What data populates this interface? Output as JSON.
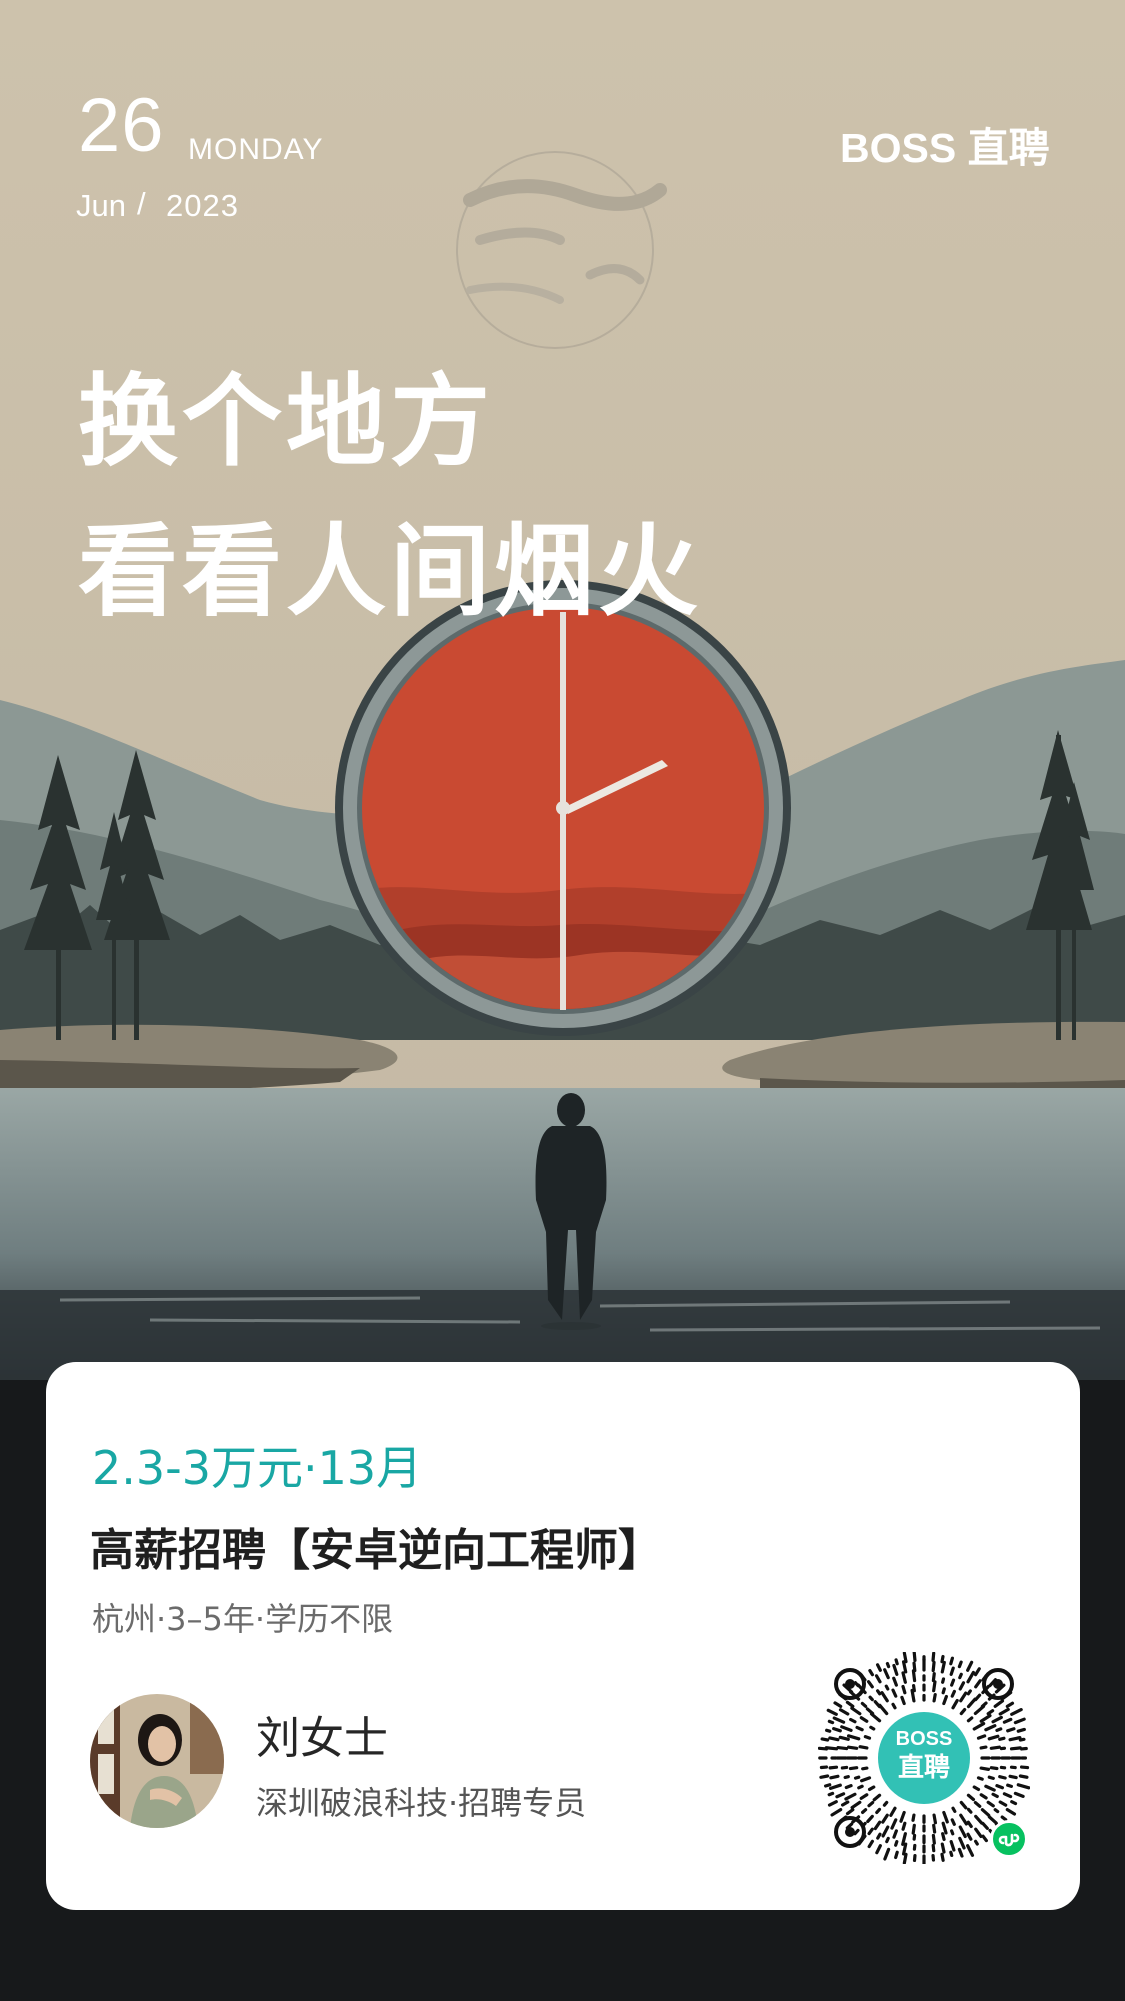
{
  "header": {
    "day": "26",
    "weekday": "MONDAY",
    "month": "Jun",
    "separator": "/",
    "year": "2023",
    "brand": "BOSS 直聘"
  },
  "headline": {
    "line1": "换个地方",
    "line2": "看看人间烟火"
  },
  "job": {
    "salary": "2.3-3万元·13月",
    "title": "高薪招聘【安卓逆向工程师】",
    "meta": "杭州·3–5年·学历不限"
  },
  "recruiter": {
    "name": "刘女士",
    "company": "深圳破浪科技·招聘专员"
  },
  "qr": {
    "badge_line1": "BOSS",
    "badge_line2": "直聘"
  },
  "colors": {
    "accent": "#19a7a4",
    "sky": "#cbbfa9",
    "clock_face": "#c94a32",
    "badge": "#32c1b5",
    "wechat_green": "#07c160"
  }
}
